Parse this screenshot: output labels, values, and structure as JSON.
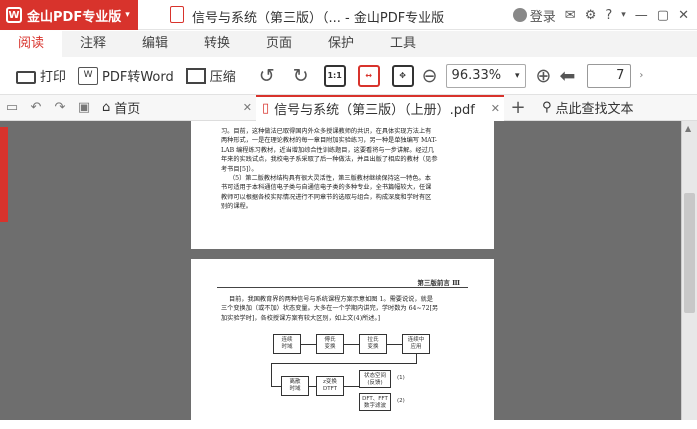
{
  "app": {
    "brand": "金山PDF专业版",
    "window_title": "信号与系统（第三版）（... - 金山PDF专业版",
    "login": "登录"
  },
  "menu": [
    "阅读",
    "注释",
    "编辑",
    "转换",
    "页面",
    "保护",
    "工具"
  ],
  "toolbar": {
    "print": "打印",
    "pdf2word": "PDF转Word",
    "compress": "压缩",
    "fit_label": "1:1",
    "zoom": "96.33%",
    "page": "7"
  },
  "tabs": {
    "home": "首页",
    "doc": "信号与系统（第三版）（上册）.pdf",
    "find": "点此查找文本"
  },
  "page1": {
    "lines": [
      "习。目前，这种做法已取得国内外众多授课教师的共识，在具体实现方法上有",
      "两种形式，一是在理论教材的每一章目附加实验练习，另一种是单独编写 MAT-",
      "LAB 编程练习教材，近当增加综合性训练题目，这要看将与一步讲解。经过几",
      "年来的实践试点，我校电子系采取了后一种做法，并且出版了相应的教材（见参",
      "考书目[5]）。",
      "（5）第二版教材结构具有很大灵活性，第三版教材继续保持这一特色。本",
      "书可适用于本科通信电子类与自通信电子类的多种专业，全书篇幅较大，任课",
      "教师可以根据各校实际情况进行不同章节的选取与组合，构成深度和学时有区",
      "别的课程。"
    ]
  },
  "page2": {
    "header": "第三版前言  Ⅲ",
    "lines": [
      "目前，我国教育界的两种信号与系统课程方案示意如图 1。需要说说，就是",
      "三个变换加（或不加）状态变量。大多在一个学期内讲完，学时数为 64~72[另",
      "加实验学时]，各校授课方案有较大区别，如上文(4)所述。]"
    ],
    "diagram": {
      "boxes": [
        "连续\n时域",
        "傅氏\n变换",
        "拉氏\n变换",
        "连续中\n应用",
        "离散\n时域",
        "z变换\nDTFT",
        "状态空间\n(反馈)",
        "DFT、FFT\n数字滤波"
      ],
      "labels": [
        "(1)",
        "(2)"
      ]
    }
  }
}
